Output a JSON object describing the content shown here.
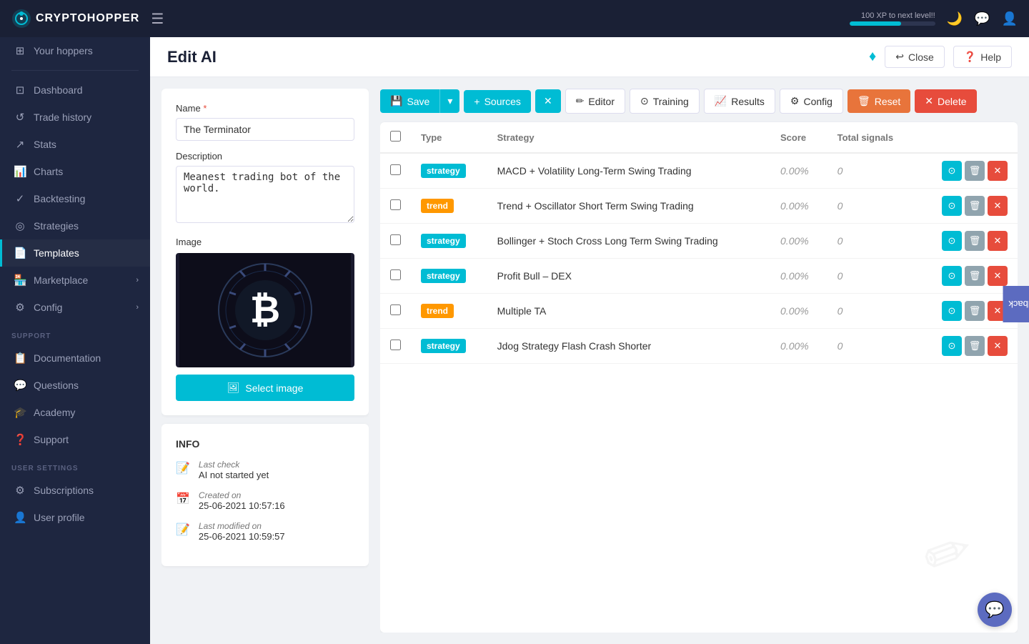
{
  "app": {
    "name": "CRYPTOHOPPER",
    "logo_dot_char": "○"
  },
  "topnav": {
    "xp_text": "100 XP to next level!!",
    "xp_pct": 60
  },
  "sidebar": {
    "items": [
      {
        "id": "your-hoppers",
        "label": "Your hoppers",
        "icon": "⊞"
      },
      {
        "id": "dashboard",
        "label": "Dashboard",
        "icon": "⊡"
      },
      {
        "id": "trade-history",
        "label": "Trade history",
        "icon": "↺"
      },
      {
        "id": "stats",
        "label": "Stats",
        "icon": "↗"
      },
      {
        "id": "charts",
        "label": "Charts",
        "icon": "📊"
      },
      {
        "id": "backtesting",
        "label": "Backtesting",
        "icon": "✓"
      },
      {
        "id": "strategies",
        "label": "Strategies",
        "icon": "◎"
      },
      {
        "id": "templates",
        "label": "Templates",
        "icon": "📄"
      },
      {
        "id": "marketplace",
        "label": "Marketplace",
        "icon": "🏪",
        "expand": "›"
      },
      {
        "id": "config",
        "label": "Config",
        "icon": "⚙",
        "expand": "›"
      }
    ],
    "support_section": "SUPPORT",
    "support_items": [
      {
        "id": "documentation",
        "label": "Documentation",
        "icon": "📋"
      },
      {
        "id": "questions",
        "label": "Questions",
        "icon": "💬"
      },
      {
        "id": "academy",
        "label": "Academy",
        "icon": "🎓"
      },
      {
        "id": "support",
        "label": "Support",
        "icon": "❓"
      }
    ],
    "user_section": "USER SETTINGS",
    "user_items": [
      {
        "id": "subscriptions",
        "label": "Subscriptions",
        "icon": "⚙"
      },
      {
        "id": "user-profile",
        "label": "User profile",
        "icon": "👤"
      }
    ]
  },
  "page": {
    "title": "Edit AI",
    "close_label": "Close",
    "help_label": "Help"
  },
  "form": {
    "name_label": "Name",
    "name_value": "The Terminator",
    "name_placeholder": "The Terminator",
    "description_label": "Description",
    "description_value": "Meanest trading bot of the world.",
    "image_label": "Image",
    "select_image_label": "Select image"
  },
  "info": {
    "title": "INFO",
    "last_check_label": "Last check",
    "last_check_value": "AI not started yet",
    "created_on_label": "Created on",
    "created_on_value": "25-06-2021 10:57:16",
    "last_modified_label": "Last modified on",
    "last_modified_value": "25-06-2021 10:59:57"
  },
  "toolbar": {
    "save_label": "Save",
    "sources_label": "Sources",
    "editor_label": "Editor",
    "training_label": "Training",
    "results_label": "Results",
    "config_label": "Config",
    "reset_label": "Reset",
    "delete_label": "Delete"
  },
  "table": {
    "col_type": "Type",
    "col_strategy": "Strategy",
    "col_score": "Score",
    "col_total_signals": "Total signals",
    "rows": [
      {
        "type": "strategy",
        "strategy": "MACD + Volatility Long-Term Swing Trading",
        "score": "0.00%",
        "total": "0"
      },
      {
        "type": "trend",
        "strategy": "Trend + Oscillator Short Term Swing Trading",
        "score": "0.00%",
        "total": "0"
      },
      {
        "type": "strategy",
        "strategy": "Bollinger + Stoch Cross Long Term Swing Trading",
        "score": "0.00%",
        "total": "0"
      },
      {
        "type": "strategy",
        "strategy": "Profit Bull – DEX",
        "score": "0.00%",
        "total": "0"
      },
      {
        "type": "trend",
        "strategy": "Multiple TA",
        "score": "0.00%",
        "total": "0"
      },
      {
        "type": "strategy",
        "strategy": "Jdog Strategy Flash Crash Shorter",
        "score": "0.00%",
        "total": "0"
      }
    ]
  },
  "feedback": {
    "label": "Feedback"
  },
  "chat": {
    "icon": "💬"
  }
}
